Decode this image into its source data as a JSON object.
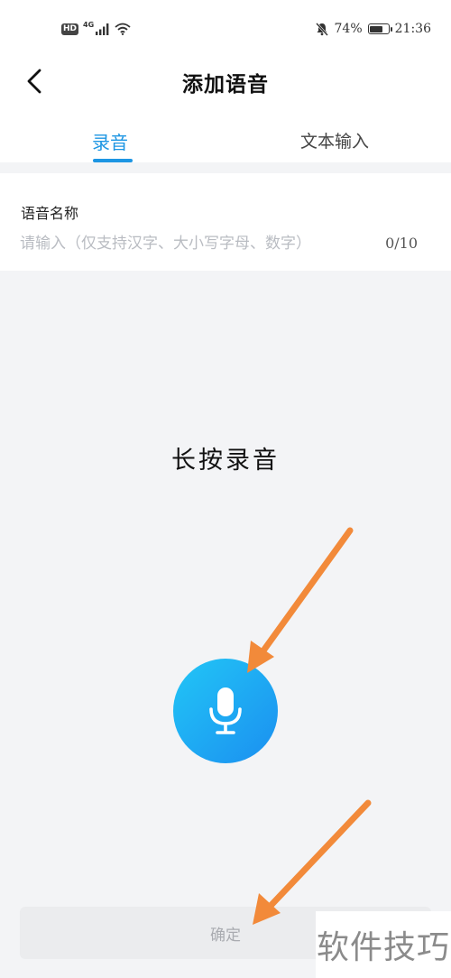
{
  "status_bar": {
    "left_badge": "HD",
    "network": "4G",
    "battery_percent": "74%",
    "battery_level": 0.74,
    "time": "21:36"
  },
  "header": {
    "back_icon": "chevron-left-icon",
    "title": "添加语音"
  },
  "tabs": [
    {
      "label": "录音",
      "active": true
    },
    {
      "label": "文本输入",
      "active": false
    }
  ],
  "name_section": {
    "label": "语音名称",
    "value": "",
    "placeholder": "请输入（仅支持汉字、大小写字母、数字）",
    "counter": "0/10"
  },
  "record": {
    "hint": "长按录音",
    "icon": "microphone-icon"
  },
  "confirm_label": "确定",
  "watermark": "软件技巧",
  "colors": {
    "accent": "#1d96e3",
    "mic_gradient_start": "#22c6f6",
    "mic_gradient_end": "#1b8ff0",
    "arrow": "#f28a3a",
    "background": "#f3f4f6"
  }
}
